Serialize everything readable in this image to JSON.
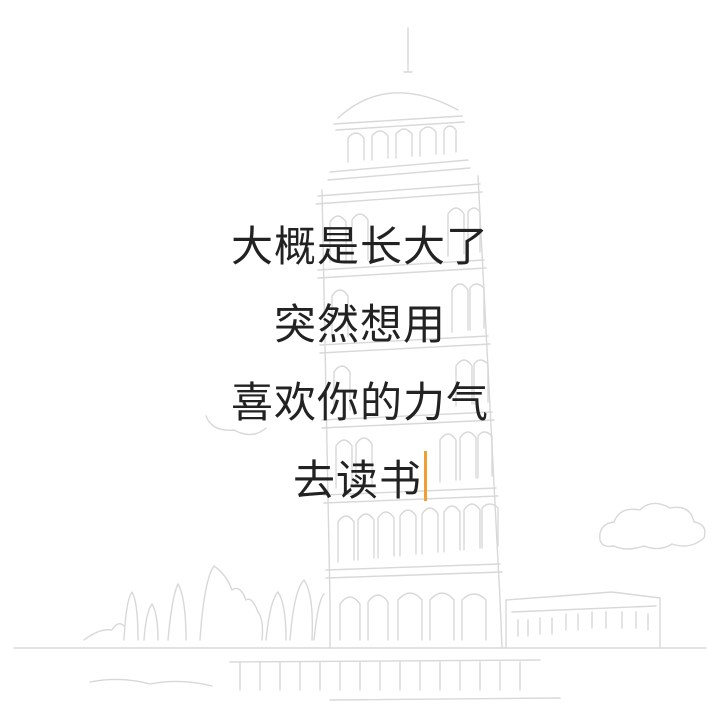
{
  "poem": {
    "lines": [
      "大概是长大了",
      "突然想用",
      "喜欢你的力气",
      "去读书"
    ]
  },
  "background": {
    "illustration": "leaning-tower-of-pisa-sketch",
    "sketch_color": "#d8d8d8"
  },
  "caret": {
    "color": "#f0a030"
  },
  "text_color": "#222222"
}
